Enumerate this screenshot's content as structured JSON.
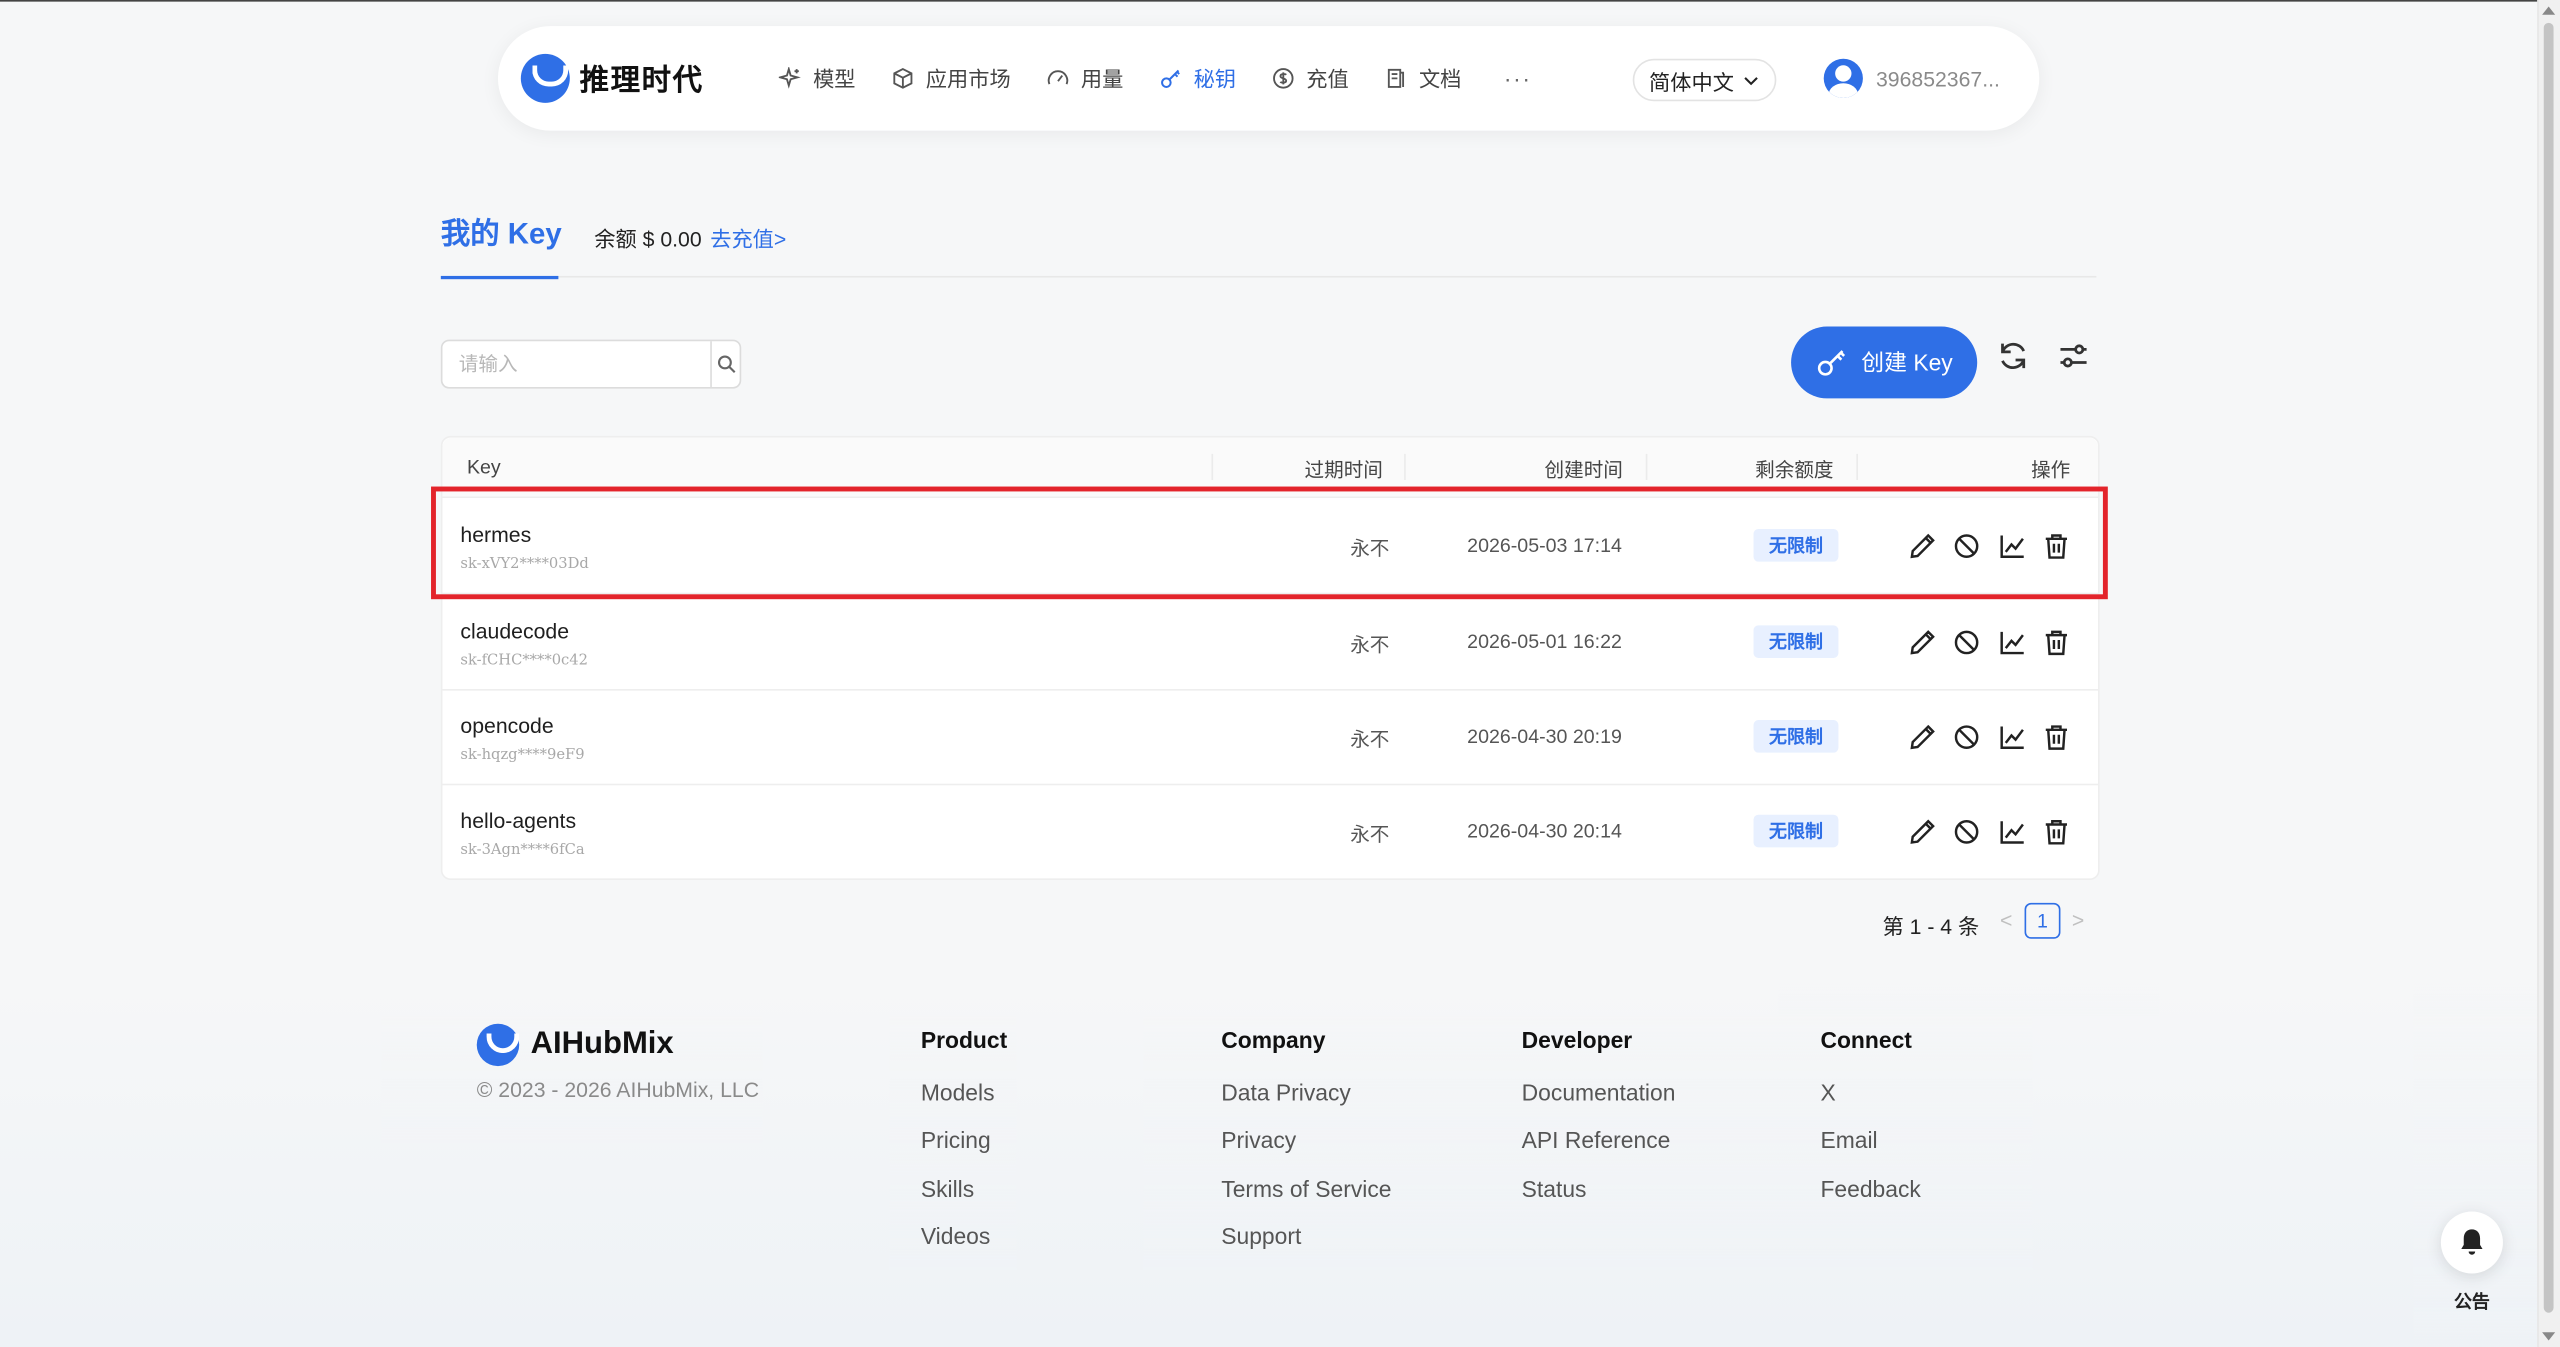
{
  "nav": {
    "brand": "推理时代",
    "items": [
      {
        "label": "模型",
        "icon": "sparkle-icon",
        "active": false
      },
      {
        "label": "应用市场",
        "icon": "box-icon",
        "active": false
      },
      {
        "label": "用量",
        "icon": "gauge-icon",
        "active": false
      },
      {
        "label": "秘钥",
        "icon": "key-icon",
        "active": true
      },
      {
        "label": "充值",
        "icon": "dollar-icon",
        "active": false
      },
      {
        "label": "文档",
        "icon": "document-icon",
        "active": false
      }
    ],
    "more": "···",
    "language": "简体中文",
    "user": "396852367..."
  },
  "header": {
    "title": "我的 Key",
    "balance": "余额 $ 0.00",
    "recharge": "去充值>"
  },
  "search": {
    "placeholder": "请输入"
  },
  "toolbar": {
    "create_label": "创建 Key"
  },
  "table": {
    "columns": {
      "key": "Key",
      "expire": "过期时间",
      "created": "创建时间",
      "quota": "剩余额度",
      "actions": "操作"
    },
    "rows": [
      {
        "name": "hermes",
        "masked": "sk-xVY2****03Dd",
        "expire": "永不",
        "created": "2026-05-03 17:14",
        "quota": "无限制"
      },
      {
        "name": "claudecode",
        "masked": "sk-fCHC****0c42",
        "expire": "永不",
        "created": "2026-05-01 16:22",
        "quota": "无限制"
      },
      {
        "name": "opencode",
        "masked": "sk-hqzg****9eF9",
        "expire": "永不",
        "created": "2026-04-30 20:19",
        "quota": "无限制"
      },
      {
        "name": "hello-agents",
        "masked": "sk-3Agn****6fCa",
        "expire": "永不",
        "created": "2026-04-30 20:14",
        "quota": "无限制"
      }
    ]
  },
  "pagination": {
    "summary": "第 1 - 4 条",
    "current": "1",
    "prev": "<",
    "next": ">"
  },
  "footer": {
    "brand": "AIHubMix",
    "copyright": "© 2023 - 2026 AIHubMix, LLC",
    "columns": [
      {
        "title": "Product",
        "links": [
          "Models",
          "Pricing",
          "Skills",
          "Videos"
        ]
      },
      {
        "title": "Company",
        "links": [
          "Data Privacy",
          "Privacy",
          "Terms of Service",
          "Support"
        ]
      },
      {
        "title": "Developer",
        "links": [
          "Documentation",
          "API Reference",
          "Status"
        ]
      },
      {
        "title": "Connect",
        "links": [
          "X",
          "Email",
          "Feedback"
        ]
      }
    ]
  },
  "notice": {
    "label": "公告"
  },
  "colors": {
    "accent": "#2f6fe6",
    "highlight": "#e3242b"
  }
}
